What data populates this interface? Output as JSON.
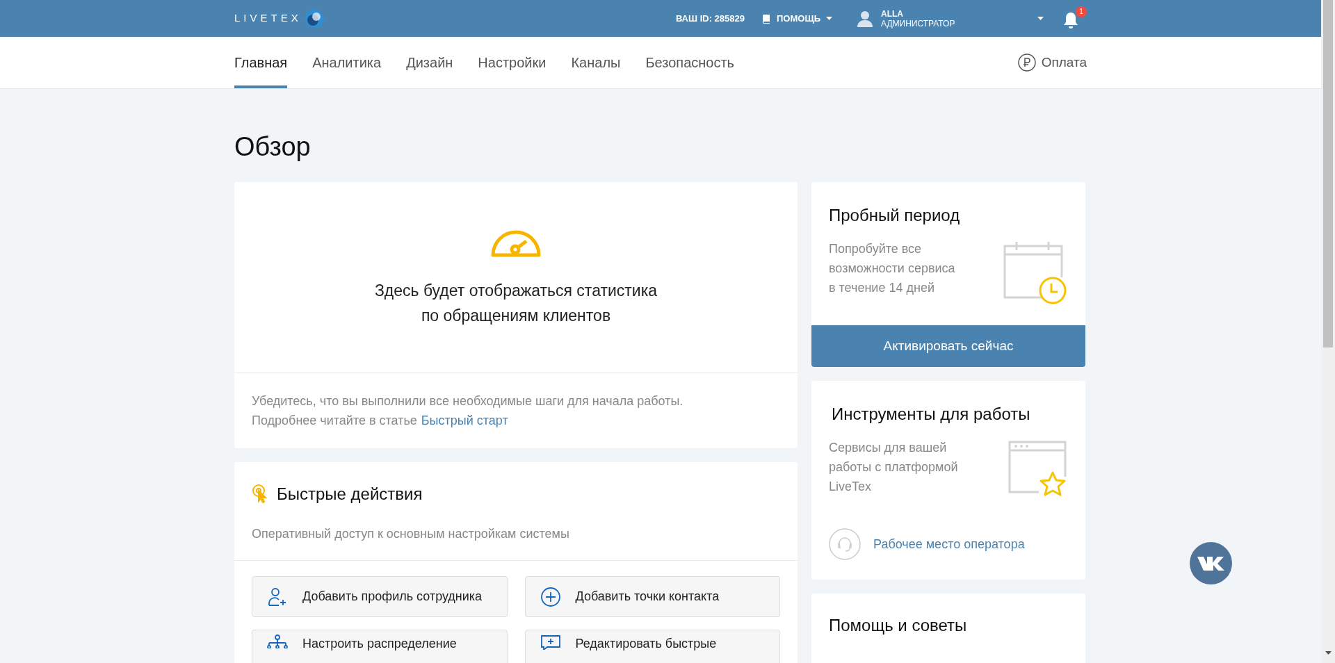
{
  "header": {
    "logo": "LIVETEX",
    "id_label": "ВАШ ID: 285829",
    "help": "ПОМОЩЬ",
    "user": {
      "name": "ALLA",
      "role": "АДМИНИСТРАТОР"
    },
    "notifications": "1"
  },
  "tabs": [
    {
      "label": "Главная",
      "selected": true
    },
    {
      "label": "Аналитика",
      "selected": false
    },
    {
      "label": "Дизайн",
      "selected": false
    },
    {
      "label": "Настройки",
      "selected": false
    },
    {
      "label": "Каналы",
      "selected": false
    },
    {
      "label": "Безопасность",
      "selected": false
    }
  ],
  "payment": "Оплата",
  "page_title": "Обзор",
  "stats": {
    "message_lines": [
      "Здесь будет отображаться статистика",
      "по обращениям клиентов"
    ],
    "hint": "Убедитесь, что вы выполнили все необходимые шаги для начала работы.",
    "hint2": "Подробнее читайте в статье",
    "hint_link": "Быстрый старт"
  },
  "quick_actions": {
    "title": "Быстрые действия",
    "subtitle": "Оперативный доступ к основным настройкам системы",
    "actions": [
      {
        "kind": "user-add",
        "label": "Добавить профиль сотрудника"
      },
      {
        "kind": "plus",
        "label": "Добавить точки контакта"
      },
      {
        "kind": "hierarchy",
        "label": "Настроить распределение"
      },
      {
        "kind": "message",
        "label": "Редактировать быстрые"
      }
    ]
  },
  "trial": {
    "title": "Пробный период",
    "lines": [
      "Попробуйте все",
      "возможности сервиса",
      "в течение 14 дней"
    ],
    "button": "Активировать сейчас"
  },
  "tools": {
    "title": "Инструменты для работы",
    "lines": [
      "Сервисы для вашей",
      "работы с платформой",
      "LiveTex"
    ],
    "link": "Рабочее место оператора"
  },
  "help_card": {
    "title": "Помощь и советы"
  }
}
